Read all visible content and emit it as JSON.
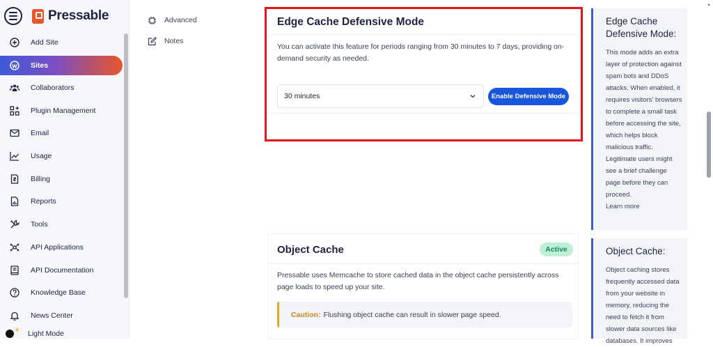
{
  "brand": {
    "name": "Pressable"
  },
  "sidebar": {
    "items": [
      {
        "label": "Add Site",
        "icon": "plus-circle-icon"
      },
      {
        "label": "Sites",
        "icon": "wordpress-icon",
        "active": true
      },
      {
        "label": "Collaborators",
        "icon": "people-icon"
      },
      {
        "label": "Plugin Management",
        "icon": "grid-plus-icon"
      },
      {
        "label": "Email",
        "icon": "envelope-icon"
      },
      {
        "label": "Usage",
        "icon": "chart-line-icon"
      },
      {
        "label": "Billing",
        "icon": "invoice-icon"
      },
      {
        "label": "Reports",
        "icon": "report-icon"
      },
      {
        "label": "Tools",
        "icon": "wrench-icon"
      },
      {
        "label": "API Applications",
        "icon": "nodes-icon"
      },
      {
        "label": "API Documentation",
        "icon": "book-icon"
      },
      {
        "label": "Knowledge Base",
        "icon": "question-icon"
      },
      {
        "label": "News Center",
        "icon": "bell-icon"
      }
    ],
    "mode_label": "Light Mode"
  },
  "subnav": {
    "items": [
      {
        "label": "Advanced",
        "icon": "chip-icon"
      },
      {
        "label": "Notes",
        "icon": "edit-icon"
      }
    ]
  },
  "edge_cache": {
    "title": "Edge Cache Defensive Mode",
    "description": "You can activate this feature for periods ranging from 30 minutes to 7 days, providing on-demand security as needed.",
    "duration_selected": "30 minutes",
    "button_label": "Enable Defensive Mode",
    "highlight_color": "#e5141b"
  },
  "object_cache": {
    "title": "Object Cache",
    "status": "Active",
    "description": "Pressable uses Memcache to store cached data in the object cache persistently across page loads to speed up your site.",
    "caution_label": "Caution:",
    "caution_text": "Flushing object cache can result in slower page speed."
  },
  "help": {
    "edge": {
      "title": "Edge Cache Defensive Mode:",
      "body": "This mode adds an extra layer of protection against spam bots and DDoS attacks. When enabled, it requires visitors' browsers to complete a small task before accessing the site, which helps block malicious traffic. Legitimate users might see a brief challenge page before they can proceed.",
      "link": "Learn more"
    },
    "object": {
      "title": "Object Cache:",
      "body": "Object caching stores frequently accessed data from your website in memory, reducing the need to fetch it from slower data sources like databases. It improves"
    }
  },
  "colors": {
    "primary": "#1a56db",
    "brand": "#e8562a",
    "active_badge_bg": "#bff0d7",
    "caution": "#e0a82a"
  }
}
